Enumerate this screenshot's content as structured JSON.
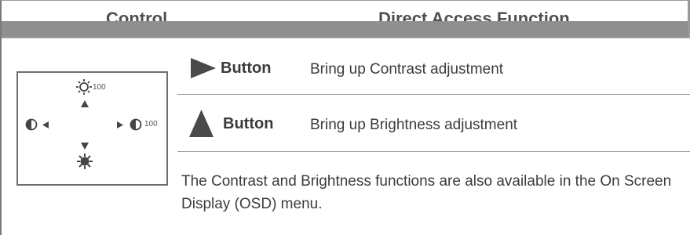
{
  "header": {
    "control_label": "Control",
    "function_label": "Direct Access Function"
  },
  "osd_diagram": {
    "brightness_value": "100",
    "contrast_value": "100",
    "icons": [
      "sun-outline-icon",
      "up-arrow-icon",
      "contrast-half-icon",
      "left-arrow-icon",
      "right-arrow-icon",
      "contrast-half-icon",
      "down-arrow-icon",
      "sun-filled-icon"
    ]
  },
  "rows": [
    {
      "icon": "right-triangle-icon",
      "button_label": "Button",
      "description": "Bring up Contrast adjustment"
    },
    {
      "icon": "up-triangle-icon",
      "button_label": "Button",
      "description": "Bring up Brightness adjustment"
    }
  ],
  "note": "The Contrast and Brightness functions are also available in the On Screen Display (OSD) menu.",
  "colors": {
    "header_bar": "#8f8f8f",
    "text": "#3c3c3c",
    "icon": "#4a4a4a"
  }
}
